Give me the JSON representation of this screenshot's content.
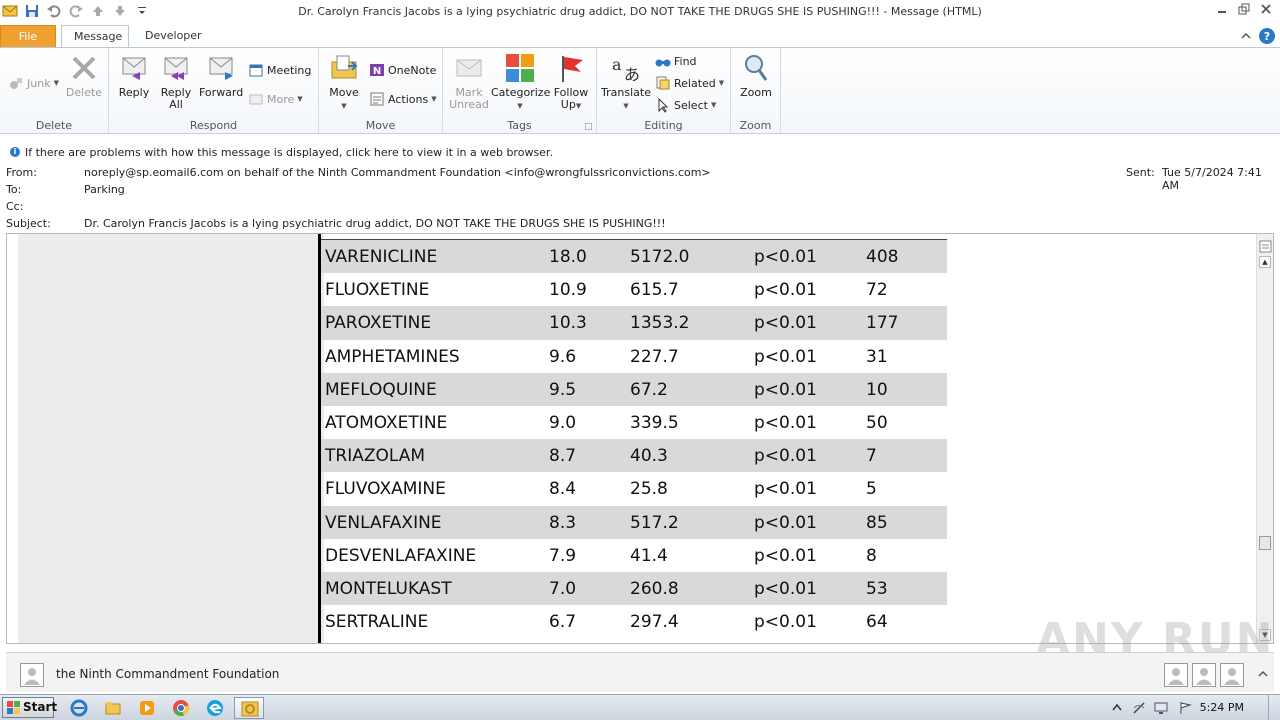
{
  "window": {
    "title": "Dr. Carolyn Francis Jacobs is a lying psychiatric drug addict, DO NOT TAKE THE DRUGS SHE IS PUSHING!!!  -  Message (HTML)"
  },
  "tabs": [
    {
      "label": "File"
    },
    {
      "label": "Message"
    },
    {
      "label": "Developer"
    }
  ],
  "ribbon": {
    "groups": {
      "delete": {
        "label": "Delete",
        "junk": "Junk",
        "delete": "Delete"
      },
      "respond": {
        "label": "Respond",
        "reply": "Reply",
        "reply_all_1": "Reply",
        "reply_all_2": "All",
        "forward": "Forward",
        "meeting": "Meeting",
        "more": "More"
      },
      "move": {
        "label": "Move",
        "move": "Move",
        "onenote": "OneNote",
        "actions": "Actions"
      },
      "tags": {
        "label": "Tags",
        "mark_1": "Mark",
        "mark_2": "Unread",
        "categorize": "Categorize",
        "follow_1": "Follow",
        "follow_2": "Up"
      },
      "editing": {
        "label": "Editing",
        "translate": "Translate",
        "find": "Find",
        "related": "Related",
        "select": "Select"
      },
      "zoom": {
        "label": "Zoom",
        "zoom": "Zoom"
      }
    }
  },
  "message": {
    "info": "If there are problems with how this message is displayed, click here to view it in a web browser.",
    "from_label": "From:",
    "from": "noreply@sp.eomail6.com on behalf of the Ninth Commandment Foundation <info@wrongfulssriconvictions.com>",
    "to_label": "To:",
    "to": "Parking",
    "cc_label": "Cc:",
    "subject_label": "Subject:",
    "subject": "Dr. Carolyn Francis Jacobs is a lying psychiatric drug addict, DO NOT TAKE THE DRUGS SHE IS PUSHING!!!",
    "sent_label": "Sent:",
    "sent": "Tue 5/7/2024 7:41 AM"
  },
  "drug_table": [
    {
      "name": "VARENICLINE",
      "v1": "18.0",
      "v2": "5172.0",
      "p": "p<0.01",
      "n": "408"
    },
    {
      "name": "FLUOXETINE",
      "v1": "10.9",
      "v2": "615.7",
      "p": "p<0.01",
      "n": "72"
    },
    {
      "name": "PAROXETINE",
      "v1": "10.3",
      "v2": "1353.2",
      "p": "p<0.01",
      "n": "177"
    },
    {
      "name": "AMPHETAMINES",
      "v1": "9.6",
      "v2": "227.7",
      "p": "p<0.01",
      "n": "31"
    },
    {
      "name": "MEFLOQUINE",
      "v1": "9.5",
      "v2": "67.2",
      "p": "p<0.01",
      "n": "10"
    },
    {
      "name": "ATOMOXETINE",
      "v1": "9.0",
      "v2": "339.5",
      "p": "p<0.01",
      "n": "50"
    },
    {
      "name": "TRIAZOLAM",
      "v1": "8.7",
      "v2": "40.3",
      "p": "p<0.01",
      "n": "7"
    },
    {
      "name": "FLUVOXAMINE",
      "v1": "8.4",
      "v2": "25.8",
      "p": "p<0.01",
      "n": "5"
    },
    {
      "name": "VENLAFAXINE",
      "v1": "8.3",
      "v2": "517.2",
      "p": "p<0.01",
      "n": "85"
    },
    {
      "name": "DESVENLAFAXINE",
      "v1": "7.9",
      "v2": "41.4",
      "p": "p<0.01",
      "n": "8"
    },
    {
      "name": "MONTELUKAST",
      "v1": "7.0",
      "v2": "260.8",
      "p": "p<0.01",
      "n": "53"
    },
    {
      "name": "SERTRALINE",
      "v1": "6.7",
      "v2": "297.4",
      "p": "p<0.01",
      "n": "64"
    }
  ],
  "people_pane": {
    "name": "the Ninth Commandment Foundation"
  },
  "watermark": "ANY RUN",
  "taskbar": {
    "start": "Start",
    "clock": "5:24 PM"
  },
  "colors": {
    "file_tab": "#f0a030",
    "shade_row": "#d9d9d9",
    "accent": "#2b78c5"
  }
}
